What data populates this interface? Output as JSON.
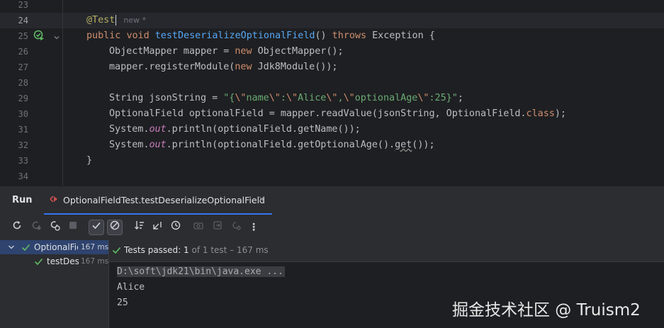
{
  "editor": {
    "line_numbers": [
      "23",
      "24",
      "25",
      "26",
      "27",
      "28",
      "29",
      "30",
      "31",
      "32",
      "33",
      "34"
    ],
    "inlay_hint": "new *",
    "lines": {
      "l24_annotation": "@Test",
      "l25_public": "public",
      "l25_void": "void",
      "l25_method": "testDeserializeOptionalField",
      "l25_params": "() ",
      "l25_throws": "throws",
      "l25_rest": " Exception {",
      "l26_a": "ObjectMapper mapper = ",
      "l26_new": "new",
      "l26_b": " ObjectMapper();",
      "l27_a": "mapper.registerModule(",
      "l27_new": "new",
      "l27_b": " Jdk8Module());",
      "l29_a": "String jsonString = ",
      "l29_s1": "\"{",
      "l29_e1": "\\\"",
      "l29_s2": "name",
      "l29_e2": "\\\"",
      "l29_s3": ":",
      "l29_e3": "\\\"",
      "l29_s4": "Alice",
      "l29_e4": "\\\"",
      "l29_s5": ",",
      "l29_e5": "\\\"",
      "l29_s6": "optionalAge",
      "l29_e6": "\\\"",
      "l29_s7": ":25}\"",
      "l29_b": ";",
      "l30_a": "OptionalField optionalField = mapper.readValue(jsonString, OptionalField.",
      "l30_class": "class",
      "l30_b": ");",
      "l31_a": "System.",
      "l31_out": "out",
      "l31_b": ".println(optionalField.getName());",
      "l32_a": "System.",
      "l32_out": "out",
      "l32_b": ".println(optionalField.getOptionalAge().",
      "l32_get": "get",
      "l32_c": "());",
      "l33": "}"
    }
  },
  "run_panel": {
    "label": "Run",
    "tab_title": "OptionalFieldTest.testDeserializeOptionalField",
    "tab_close": "×"
  },
  "toolbar": {
    "icons": [
      "rerun-icon",
      "rerun-failed-icon",
      "toggle-auto-test-icon",
      "stop-icon",
      "show-passed-icon",
      "show-ignored-icon",
      "sort-icon",
      "collapse-icon",
      "history-icon",
      "camera-icon",
      "export-icon",
      "settings-icon",
      "more-icon"
    ]
  },
  "tree": {
    "root_label": "OptionalFie",
    "root_time": "167 ms",
    "child_label": "testDese",
    "child_time": "167 ms"
  },
  "status": {
    "prefix": "Tests passed:",
    "count": "1",
    "suffix": "of 1 test – 167 ms"
  },
  "console": {
    "command": "D:\\soft\\jdk21\\bin\\java.exe ...",
    "out1": "Alice",
    "out2": "25"
  },
  "watermark": "掘金技术社区 @ Truism2",
  "colors": {
    "accent": "#3574f0",
    "pass": "#5fb865",
    "background": "#1e1f22",
    "panel": "#2b2d30"
  }
}
